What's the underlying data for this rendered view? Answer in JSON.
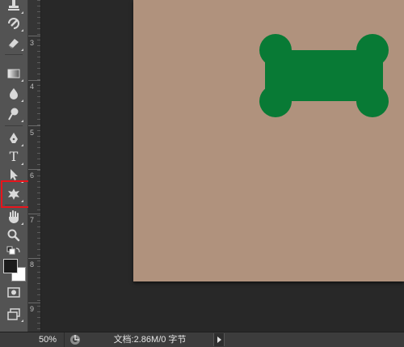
{
  "ruler": {
    "labels": [
      "3",
      "4",
      "5",
      "6",
      "7",
      "8",
      "9"
    ]
  },
  "toolbar": {
    "type_tool_glyph": "T",
    "highlighted_tool": "custom-shape-tool"
  },
  "canvas": {
    "background_color": "#b0927d",
    "shape": "bone",
    "shape_color": "#087a35"
  },
  "status": {
    "zoom": "50%",
    "doc_info": "文档:2.86M/0 字节"
  },
  "colors": {
    "highlight_border": "#e8141b",
    "foreground_swatch": "#1b1b1b",
    "background_swatch": "#ffffff"
  }
}
